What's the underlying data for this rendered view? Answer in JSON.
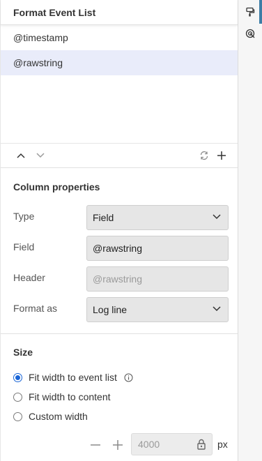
{
  "panel": {
    "title": "Format Event List"
  },
  "columns_list": [
    {
      "label": "@timestamp",
      "selected": false
    },
    {
      "label": "@rawstring",
      "selected": true
    }
  ],
  "toolbar": {
    "move_up_icon": "chevron-up-icon",
    "move_down_icon": "chevron-down-icon",
    "reset_icon": "refresh-icon",
    "add_icon": "plus-icon"
  },
  "column_properties": {
    "title": "Column properties",
    "type": {
      "label": "Type",
      "value": "Field"
    },
    "field": {
      "label": "Field",
      "value": "@rawstring"
    },
    "header": {
      "label": "Header",
      "placeholder": "@rawstring"
    },
    "format_as": {
      "label": "Format as",
      "value": "Log line"
    }
  },
  "size": {
    "title": "Size",
    "options": [
      {
        "label": "Fit width to event list",
        "checked": true
      },
      {
        "label": "Fit width to content",
        "checked": false
      },
      {
        "label": "Custom width",
        "checked": false
      }
    ],
    "custom_width": {
      "value": "4000",
      "unit": "px"
    }
  },
  "colors": {
    "accent": "#1a65d6",
    "selected_row": "#e9ecfa",
    "rail_accent": "#3d7ea6"
  }
}
